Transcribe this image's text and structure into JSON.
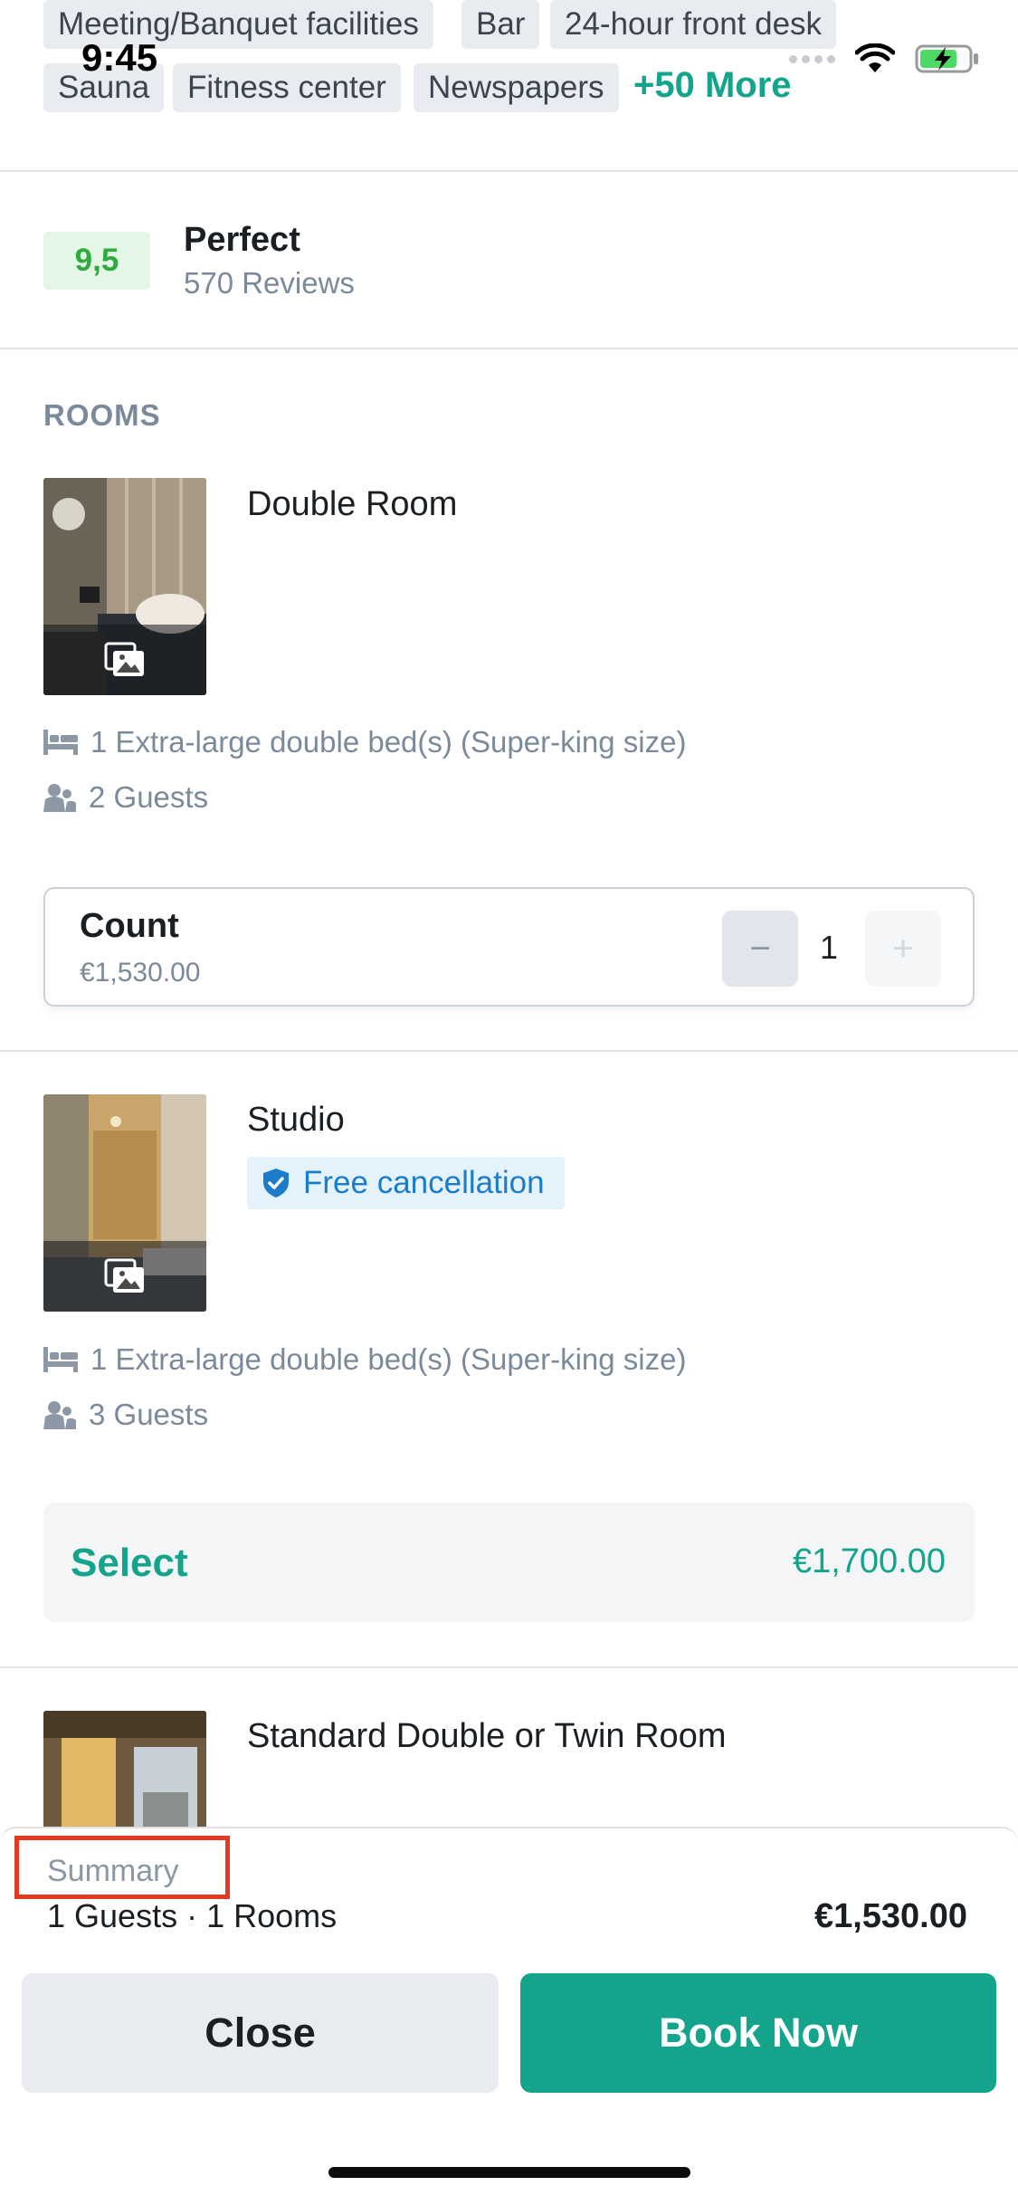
{
  "status_bar": {
    "time": "9:45"
  },
  "facilities": {
    "tags": [
      "Meeting/Banquet facilities",
      "Bar",
      "24-hour front desk",
      "Sauna",
      "Fitness center",
      "Newspapers"
    ],
    "more_label": "+50 More"
  },
  "review": {
    "score": "9,5",
    "title": "Perfect",
    "count": "570 Reviews"
  },
  "rooms_section": {
    "title": "ROOMS",
    "rooms": [
      {
        "name": "Double Room",
        "bed": "1 Extra-large double bed(s) (Super-king size)",
        "guests": "2 Guests",
        "count_label": "Count",
        "count_price": "€1,530.00",
        "count_value": "1",
        "minus_symbol": "−",
        "plus_symbol": "+"
      },
      {
        "name": "Studio",
        "badge": "Free cancellation",
        "bed": "1 Extra-large double bed(s) (Super-king size)",
        "guests": "3 Guests",
        "select_label": "Select",
        "price": "€1,700.00"
      },
      {
        "name": "Standard Double or Twin Room"
      }
    ]
  },
  "summary": {
    "label": "Summary",
    "detail": "1 Guests · 1 Rooms",
    "total": "€1,530.00",
    "close_label": "Close",
    "book_label": "Book Now"
  },
  "colors": {
    "accent": "#14a38b",
    "highlight_box": "#e53a22",
    "score_bg": "#e4f6e6",
    "score_text": "#2eaa3e",
    "info_blue": "#1c7cc9"
  },
  "icons": [
    "wifi-icon",
    "battery-icon",
    "gallery-icon",
    "bed-icon",
    "guests-icon",
    "shield-check-icon",
    "minus-icon",
    "plus-icon"
  ]
}
